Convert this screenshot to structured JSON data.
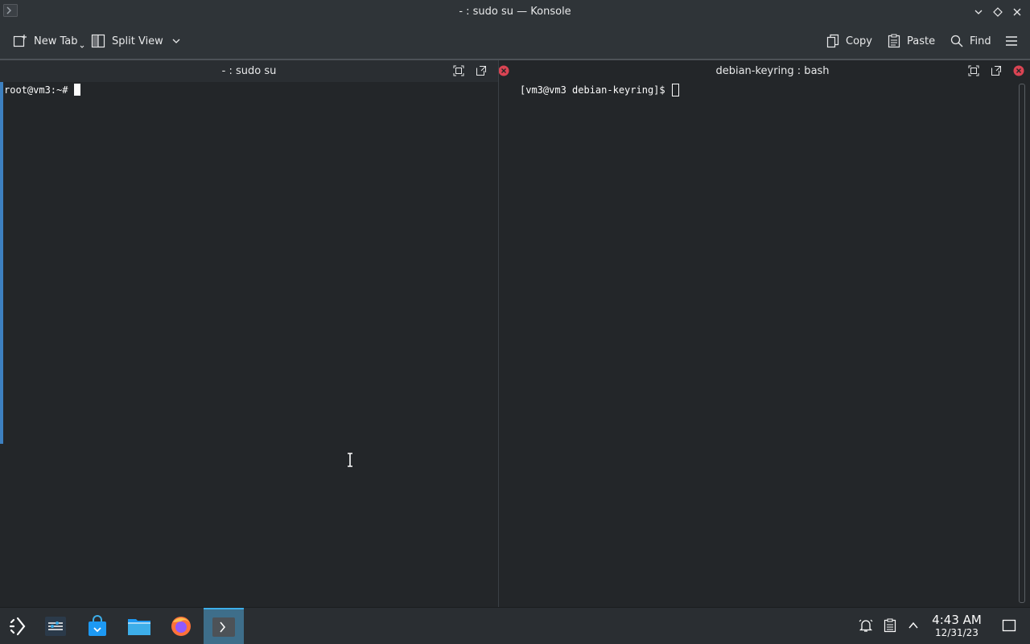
{
  "window": {
    "title": "- : sudo su — Konsole"
  },
  "toolbar": {
    "new_tab_label": "New Tab",
    "split_view_label": "Split View",
    "copy_label": "Copy",
    "paste_label": "Paste",
    "find_label": "Find"
  },
  "panes": {
    "left": {
      "title": "- : sudo su",
      "prompt": "root@vm3:~#"
    },
    "right": {
      "title": "debian-keyring : bash",
      "prompt": "[vm3@vm3 debian-keyring]$"
    }
  },
  "taskbar": {
    "apps": [
      "application-launcher-icon",
      "pager-icon",
      "discover-icon",
      "dolphin-icon",
      "firefox-icon",
      "konsole-icon"
    ],
    "clock_time": "4:43 AM",
    "clock_date": "12/31/23"
  },
  "colors": {
    "accent": "#3daee9",
    "close_red": "#da4453",
    "background": "#232629"
  }
}
